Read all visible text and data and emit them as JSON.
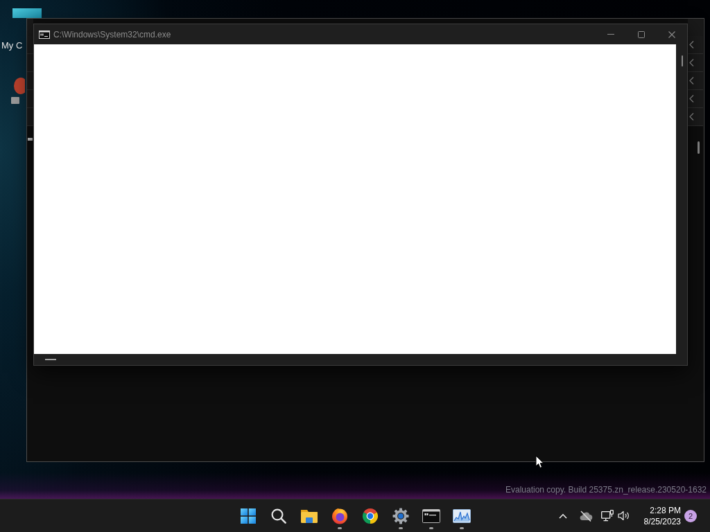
{
  "desktop": {
    "shortcut": {
      "label": "My C"
    }
  },
  "console_window": {
    "title": "C:\\Windows\\System32\\cmd.exe"
  },
  "build_info": {
    "text": "Evaluation copy. Build 25375.zn_release.230520-1632"
  },
  "taskbar": {
    "apps": [
      {
        "kind": "start",
        "running": false
      },
      {
        "kind": "search",
        "running": false
      },
      {
        "kind": "folder",
        "running": false
      },
      {
        "kind": "firefox",
        "running": true
      },
      {
        "kind": "chrome",
        "running": false
      },
      {
        "kind": "settings",
        "running": true
      },
      {
        "kind": "terminal",
        "running": true
      },
      {
        "kind": "monitor",
        "running": true
      }
    ],
    "tray": {
      "time": "2:28 PM",
      "date": "8/25/2023",
      "notification_count": "2"
    }
  }
}
